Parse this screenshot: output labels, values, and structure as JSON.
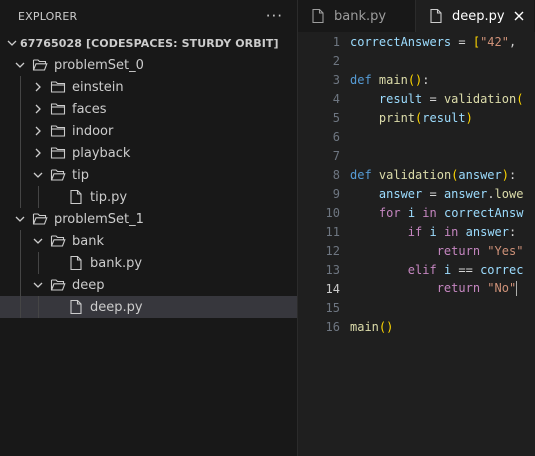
{
  "explorer": {
    "title": "EXPLORER",
    "more_label": "···",
    "workspace": "67765028 [CODESPACES: STURDY ORBIT]",
    "tree": [
      {
        "label": "problemSet_0",
        "type": "folder",
        "expanded": true,
        "depth": 0
      },
      {
        "label": "einstein",
        "type": "folder",
        "expanded": false,
        "depth": 1
      },
      {
        "label": "faces",
        "type": "folder",
        "expanded": false,
        "depth": 1
      },
      {
        "label": "indoor",
        "type": "folder",
        "expanded": false,
        "depth": 1
      },
      {
        "label": "playback",
        "type": "folder",
        "expanded": false,
        "depth": 1
      },
      {
        "label": "tip",
        "type": "folder",
        "expanded": true,
        "depth": 1
      },
      {
        "label": "tip.py",
        "type": "file",
        "depth": 2
      },
      {
        "label": "problemSet_1",
        "type": "folder",
        "expanded": true,
        "depth": 0
      },
      {
        "label": "bank",
        "type": "folder",
        "expanded": true,
        "depth": 1
      },
      {
        "label": "bank.py",
        "type": "file",
        "depth": 2
      },
      {
        "label": "deep",
        "type": "folder",
        "expanded": true,
        "depth": 1
      },
      {
        "label": "deep.py",
        "type": "file",
        "depth": 2,
        "selected": true
      }
    ]
  },
  "tabs": [
    {
      "label": "bank.py",
      "active": false
    },
    {
      "label": "deep.py",
      "active": true
    }
  ],
  "editor": {
    "active_line": 14,
    "lines": [
      {
        "n": "1",
        "tokens": [
          [
            "v",
            "correctAnswers"
          ],
          [
            "o",
            " = "
          ],
          [
            "p1",
            "["
          ],
          [
            "s",
            "\"42\""
          ],
          [
            "o",
            ",  "
          ]
        ]
      },
      {
        "n": "2",
        "tokens": []
      },
      {
        "n": "3",
        "tokens": [
          [
            "k",
            "def"
          ],
          [
            "o",
            " "
          ],
          [
            "f",
            "main"
          ],
          [
            "p1",
            "()"
          ],
          [
            "o",
            ":"
          ]
        ]
      },
      {
        "n": "4",
        "tokens": [
          [
            "o",
            "    "
          ],
          [
            "v",
            "result"
          ],
          [
            "o",
            " = "
          ],
          [
            "f",
            "validation"
          ],
          [
            "p1",
            "("
          ]
        ]
      },
      {
        "n": "5",
        "tokens": [
          [
            "o",
            "    "
          ],
          [
            "f",
            "print"
          ],
          [
            "p1",
            "("
          ],
          [
            "v",
            "result"
          ],
          [
            "p1",
            ")"
          ]
        ]
      },
      {
        "n": "6",
        "tokens": []
      },
      {
        "n": "7",
        "tokens": []
      },
      {
        "n": "8",
        "tokens": [
          [
            "k",
            "def"
          ],
          [
            "o",
            " "
          ],
          [
            "f",
            "validation"
          ],
          [
            "p1",
            "("
          ],
          [
            "v",
            "answer"
          ],
          [
            "p1",
            ")"
          ],
          [
            "o",
            ":"
          ]
        ]
      },
      {
        "n": "9",
        "tokens": [
          [
            "o",
            "    "
          ],
          [
            "v",
            "answer"
          ],
          [
            "o",
            " = "
          ],
          [
            "v",
            "answer"
          ],
          [
            "o",
            "."
          ],
          [
            "f",
            "lowe"
          ]
        ]
      },
      {
        "n": "10",
        "tokens": [
          [
            "o",
            "    "
          ],
          [
            "kc",
            "for"
          ],
          [
            "o",
            " "
          ],
          [
            "v",
            "i"
          ],
          [
            "o",
            " "
          ],
          [
            "kc",
            "in"
          ],
          [
            "o",
            " "
          ],
          [
            "v",
            "correctAnsw"
          ]
        ]
      },
      {
        "n": "11",
        "tokens": [
          [
            "o",
            "        "
          ],
          [
            "kc",
            "if"
          ],
          [
            "o",
            " "
          ],
          [
            "v",
            "i"
          ],
          [
            "o",
            " "
          ],
          [
            "kc",
            "in"
          ],
          [
            "o",
            " "
          ],
          [
            "v",
            "answer"
          ],
          [
            "o",
            ":"
          ]
        ]
      },
      {
        "n": "12",
        "tokens": [
          [
            "o",
            "            "
          ],
          [
            "kc",
            "return"
          ],
          [
            "o",
            " "
          ],
          [
            "s",
            "\"Yes\""
          ]
        ]
      },
      {
        "n": "13",
        "tokens": [
          [
            "o",
            "        "
          ],
          [
            "kc",
            "elif"
          ],
          [
            "o",
            " "
          ],
          [
            "v",
            "i"
          ],
          [
            "o",
            " == "
          ],
          [
            "v",
            "correc"
          ]
        ]
      },
      {
        "n": "14",
        "tokens": [
          [
            "o",
            "            "
          ],
          [
            "kc",
            "return"
          ],
          [
            "o",
            " "
          ],
          [
            "s",
            "\"No\""
          ]
        ]
      },
      {
        "n": "15",
        "tokens": []
      },
      {
        "n": "16",
        "tokens": [
          [
            "f",
            "main"
          ],
          [
            "p1",
            "()"
          ]
        ]
      }
    ]
  },
  "colors": {
    "sidebar_bg": "#181818",
    "editor_bg": "#1f1f1f",
    "selection_bg": "#37373d",
    "keyword": "#569cd6",
    "control": "#c586c0",
    "function": "#dcdcaa",
    "variable": "#9cdcfe",
    "string": "#ce9178",
    "bracket": "#ffd700"
  },
  "icons": {
    "more": "ellipsis-icon",
    "folder_open": "folder-open-icon",
    "folder_closed": "folder-icon",
    "file": "file-icon",
    "close": "close-icon"
  }
}
